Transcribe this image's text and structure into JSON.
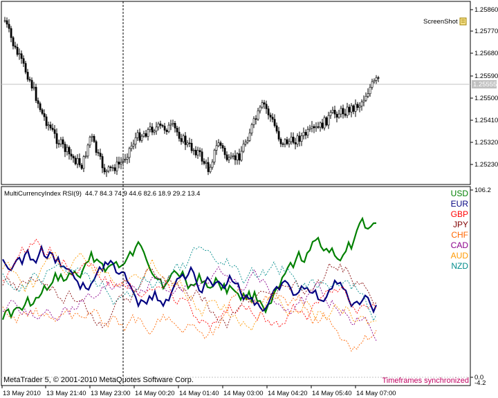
{
  "price_chart": {
    "y_ticks": [
      "1.25860",
      "1.25770",
      "1.25680",
      "1.25590",
      "1.25500",
      "1.25410",
      "1.25320",
      "1.25230"
    ],
    "current_price": "1.25555",
    "screenshot_label": "ScreenShot"
  },
  "indicator": {
    "title": "MultiCurrencyIndex  RSI(9)",
    "values": "44.7 84.3 74.9 44.6 82.6 18.9 29.2 13.4",
    "scale_top": "106.2",
    "scale_zero": "0.0",
    "scale_bottom": "-4.2",
    "legend": [
      {
        "name": "USD",
        "color": "#008000"
      },
      {
        "name": "EUR",
        "color": "#000080"
      },
      {
        "name": "GBP",
        "color": "#ff0000"
      },
      {
        "name": "JPY",
        "color": "#800000"
      },
      {
        "name": "CHF",
        "color": "#ff6600"
      },
      {
        "name": "CAD",
        "color": "#8b008b"
      },
      {
        "name": "AUD",
        "color": "#ff9900"
      },
      {
        "name": "NZD",
        "color": "#008b8b"
      }
    ],
    "copyright": "MetaTrader 5, © 2001-2010 MetaQuotes Software Corp.",
    "sync_text": "Timeframes synchronized"
  },
  "time_axis": [
    "13 May 2010",
    "13 May 21:40",
    "13 May 23:00",
    "14 May 00:20",
    "14 May 01:40",
    "14 May 03:00",
    "14 May 04:20",
    "14 May 05:40",
    "14 May 07:00"
  ]
}
